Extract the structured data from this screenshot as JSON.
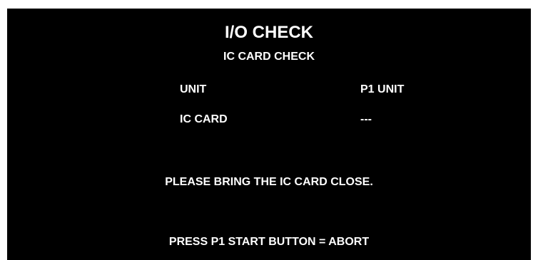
{
  "screen": {
    "title": "I/O CHECK",
    "subtitle": "IC CARD CHECK",
    "rows": [
      {
        "label": "UNIT",
        "value": "P1 UNIT"
      },
      {
        "label": "IC CARD",
        "value": "---"
      }
    ],
    "prompt": "PLEASE BRING THE IC CARD CLOSE.",
    "abort_hint": "PRESS P1 START BUTTON = ABORT"
  },
  "colors": {
    "background": "#000000",
    "text": "#ffffff",
    "page": "#ffffff"
  }
}
